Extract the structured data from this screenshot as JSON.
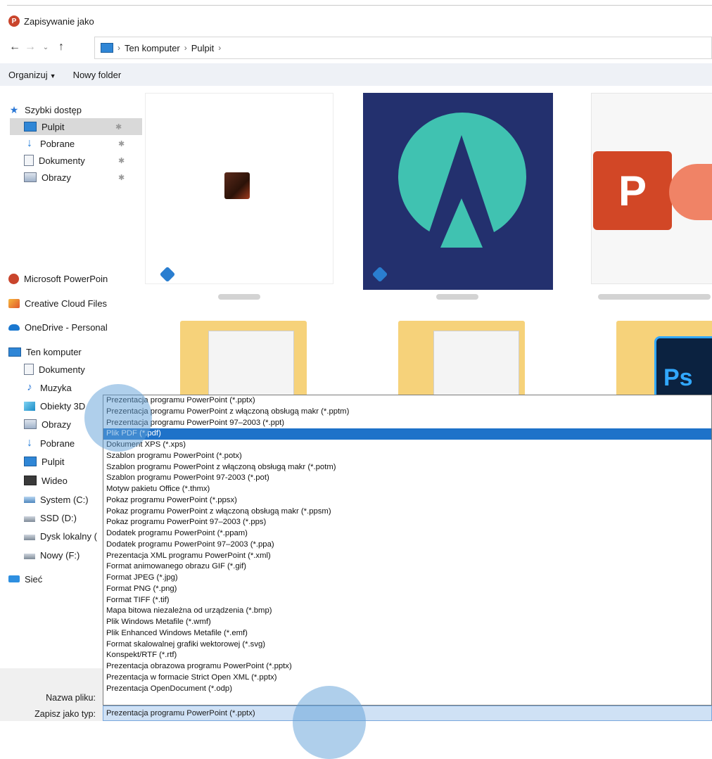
{
  "window": {
    "title": "Zapisywanie jako",
    "app_icon": "powerpoint-icon"
  },
  "nav": {
    "back_icon": "arrow-left-icon",
    "forward_icon": "arrow-right-icon",
    "recent_icon": "chevron-down-icon",
    "up_icon": "arrow-up-icon"
  },
  "address": {
    "root_icon": "computer-icon",
    "segments": [
      "Ten komputer",
      "Pulpit"
    ],
    "separator": "›"
  },
  "toolbar": {
    "organize_label": "Organizuj",
    "new_folder_label": "Nowy folder"
  },
  "sidebar": {
    "quick_access": "Szybki dostęp",
    "quick_items": [
      "Pulpit",
      "Pobrane",
      "Dokumenty",
      "Obrazy"
    ],
    "pin_glyph": "📌",
    "powerpoint": "Microsoft PowerPoin",
    "creative_cloud": "Creative Cloud Files",
    "onedrive": "OneDrive - Personal",
    "this_pc": "Ten komputer",
    "pc_items": [
      "Dokumenty",
      "Muzyka",
      "Obiekty 3D",
      "Obrazy",
      "Pobrane",
      "Pulpit",
      "Wideo",
      "System (C:)",
      "SSD (D:)",
      "Dysk lokalny (",
      "Nowy (F:)"
    ],
    "network": "Sieć"
  },
  "content": {
    "ps_label": "Ps"
  },
  "filetype_dropdown": {
    "highlighted_index": 3,
    "options": [
      "Prezentacja programu PowerPoint (*.pptx)",
      "Prezentacja programu PowerPoint z włączoną obsługą makr (*.pptm)",
      "Prezentacja programu PowerPoint 97–2003 (*.ppt)",
      "Plik PDF (*.pdf)",
      "Dokument XPS (*.xps)",
      "Szablon programu PowerPoint (*.potx)",
      "Szablon programu PowerPoint z włączoną obsługą makr (*.potm)",
      "Szablon programu PowerPoint 97-2003 (*.pot)",
      "Motyw pakietu Office (*.thmx)",
      "Pokaz programu PowerPoint (*.ppsx)",
      "Pokaz programu PowerPoint z włączoną obsługą makr (*.ppsm)",
      "Pokaz programu PowerPoint 97–2003 (*.pps)",
      "Dodatek programu PowerPoint (*.ppam)",
      "Dodatek programu PowerPoint 97–2003 (*.ppa)",
      "Prezentacja XML programu PowerPoint (*.xml)",
      "Format animowanego obrazu GIF (*.gif)",
      "Format JPEG (*.jpg)",
      "Format PNG (*.png)",
      "Format TIFF (*.tif)",
      "Mapa bitowa niezależna od urządzenia (*.bmp)",
      "Plik Windows Metafile (*.wmf)",
      "Plik Enhanced Windows Metafile (*.emf)",
      "Format skalowalnej grafiki wektorowej (*.svg)",
      "Konspekt/RTF (*.rtf)",
      "Prezentacja obrazowa programu PowerPoint (*.pptx)",
      "Prezentacja w formacie Strict Open XML (*.pptx)",
      "Prezentacja OpenDocument (*.odp)"
    ]
  },
  "form": {
    "filename_label": "Nazwa pliku:",
    "savetype_label": "Zapisz jako typ:",
    "savetype_value": "Prezentacja programu PowerPoint (*.pptx)"
  },
  "colors": {
    "highlight": "#1e72c9",
    "selected_nav": "#d9d9d9",
    "touch_indicator": "#5fa0d7"
  }
}
